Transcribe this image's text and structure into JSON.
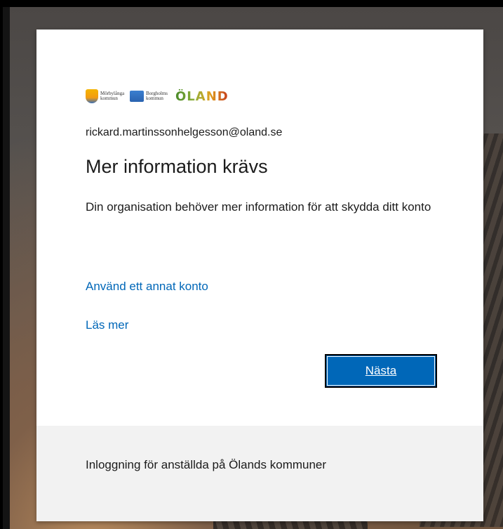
{
  "logos": {
    "logo1_text": "Mörbylånga kommun",
    "logo2_text": "Borgholms kommun",
    "logo3_text": "ÖLAND"
  },
  "account": {
    "email": "rickard.martinssonhelgesson@oland.se"
  },
  "prompt": {
    "title": "Mer information krävs",
    "description": "Din organisation behöver mer information för att skydda ditt konto"
  },
  "links": {
    "use_other_account": "Använd ett annat konto",
    "read_more": "Läs mer"
  },
  "actions": {
    "next_label": "Nästa"
  },
  "footer": {
    "text": "Inloggning för anställda på Ölands kommuner"
  },
  "colors": {
    "accent": "#0067b8",
    "footer_bg": "#f2f2f2"
  }
}
